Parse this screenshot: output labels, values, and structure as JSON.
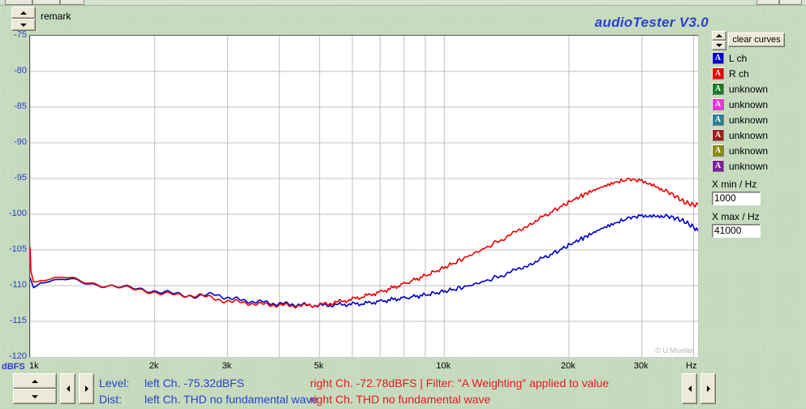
{
  "app": {
    "brand": "audioTester  V3.0",
    "remark_label": "remark",
    "watermark": "© U.Mueller"
  },
  "controls": {
    "clear_curves_label": "clear curves",
    "x_min_label": "X min / Hz",
    "x_min_value": "1000",
    "x_max_label": "X max / Hz",
    "x_max_value": "41000"
  },
  "legend": {
    "items": [
      {
        "label": "L ch",
        "color": "#0000cc",
        "glyph": "A"
      },
      {
        "label": "R ch",
        "color": "#ee0000",
        "glyph": "A"
      },
      {
        "label": "unknown",
        "color": "#1a7a28",
        "glyph": "A"
      },
      {
        "label": "unknown",
        "color": "#ee33dd",
        "glyph": "A"
      },
      {
        "label": "unknown",
        "color": "#2b8092",
        "glyph": "A"
      },
      {
        "label": "unknown",
        "color": "#9e1f1f",
        "glyph": "A"
      },
      {
        "label": "unknown",
        "color": "#8a8a12",
        "glyph": "A"
      },
      {
        "label": "unknown",
        "color": "#7a2396",
        "glyph": "A"
      }
    ]
  },
  "status": {
    "level_key": "Level:",
    "level_left": "left Ch. -75.32dBFS",
    "level_right": "right Ch. -72.78dBFS | Filter: \"A Weighting\" applied to value",
    "dist_key": "Dist:",
    "dist_left": "left Ch. THD no fundamental wave",
    "dist_right": "right Ch. THD no fundamental wave"
  },
  "chart_data": {
    "type": "line",
    "title": "",
    "xlabel": "Hz",
    "ylabel": "dBFS",
    "xscale": "log",
    "xlim": [
      1000,
      41000
    ],
    "ylim": [
      -120,
      -75
    ],
    "grid": true,
    "y_ticks": [
      -75,
      -80,
      -85,
      -90,
      -95,
      -100,
      -105,
      -110,
      -115,
      -120
    ],
    "y_tick_labels": [
      "-75",
      "-80",
      "-85",
      "-90",
      "-95",
      "-100",
      "-105",
      "-110",
      "-115",
      "-120"
    ],
    "x_ticks": [
      1000,
      2000,
      3000,
      5000,
      10000,
      20000,
      30000
    ],
    "x_tick_labels": [
      "1k",
      "2k",
      "3k",
      "5k",
      "10k",
      "20k",
      "30k"
    ],
    "legend_position": "right-panel",
    "series": [
      {
        "name": "L ch",
        "color": "#0000cc",
        "x": [
          1000,
          1020,
          1060,
          1120,
          1200,
          1300,
          1420,
          1560,
          1720,
          1900,
          2100,
          2320,
          2560,
          2800,
          3050,
          3300,
          3600,
          3900,
          4250,
          4600,
          5000,
          5400,
          5900,
          6400,
          7000,
          7600,
          8300,
          9000,
          9800,
          10600,
          11500,
          12500,
          13600,
          14800,
          16000,
          17400,
          18900,
          20500,
          22200,
          24000,
          26000,
          28000,
          30000,
          32000,
          34000,
          36000,
          38000,
          40000,
          41000
        ],
        "y": [
          -108.9,
          -110.2,
          -109.3,
          -109.5,
          -109.1,
          -109.4,
          -109.8,
          -110.0,
          -110.3,
          -110.6,
          -110.9,
          -111.3,
          -111.5,
          -111.2,
          -111.8,
          -112.1,
          -112.3,
          -112.5,
          -112.6,
          -112.7,
          -112.8,
          -112.7,
          -112.6,
          -112.5,
          -112.2,
          -111.9,
          -111.6,
          -111.3,
          -110.9,
          -110.5,
          -110.0,
          -109.4,
          -108.7,
          -107.9,
          -107.0,
          -106.1,
          -105.1,
          -104.0,
          -103.0,
          -102.0,
          -101.2,
          -100.5,
          -100.2,
          -100.1,
          -100.2,
          -100.5,
          -101.0,
          -101.8,
          -102.3
        ]
      },
      {
        "name": "R ch",
        "color": "#ee0000",
        "x": [
          1000,
          1005,
          1020,
          1060,
          1120,
          1200,
          1300,
          1420,
          1560,
          1720,
          1900,
          2100,
          2320,
          2560,
          2800,
          3050,
          3300,
          3600,
          3900,
          4250,
          4600,
          5000,
          5400,
          5900,
          6400,
          7000,
          7600,
          8300,
          9000,
          9800,
          10600,
          11500,
          12500,
          13600,
          14800,
          16000,
          17400,
          18900,
          20500,
          22200,
          24000,
          26000,
          28000,
          30000,
          32000,
          34000,
          36000,
          38000,
          40000,
          41000
        ],
        "y": [
          -104.6,
          -108.0,
          -109.4,
          -109.0,
          -109.2,
          -108.8,
          -109.3,
          -109.7,
          -110.0,
          -110.4,
          -110.7,
          -111.1,
          -111.4,
          -111.3,
          -111.9,
          -112.2,
          -112.4,
          -112.6,
          -112.7,
          -112.8,
          -112.8,
          -112.7,
          -112.4,
          -112.0,
          -111.5,
          -110.9,
          -110.2,
          -109.4,
          -108.6,
          -107.7,
          -106.8,
          -105.8,
          -104.8,
          -103.7,
          -102.6,
          -101.4,
          -100.3,
          -99.1,
          -98.0,
          -97.0,
          -96.2,
          -95.5,
          -95.1,
          -95.3,
          -95.8,
          -96.6,
          -97.4,
          -98.3,
          -98.7,
          -98.6
        ]
      }
    ]
  }
}
